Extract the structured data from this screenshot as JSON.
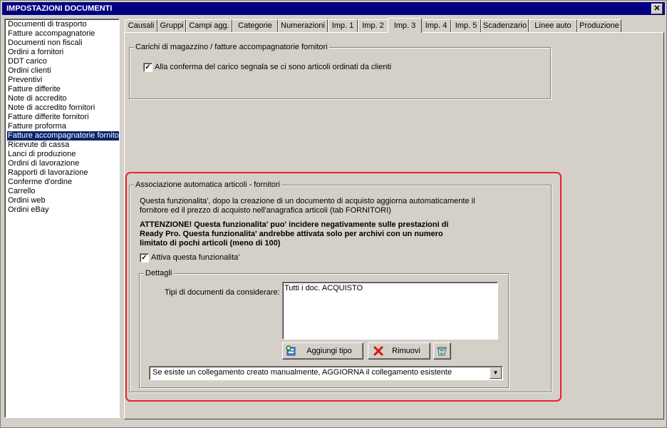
{
  "window": {
    "title": "IMPOSTAZIONI DOCUMENTI",
    "close_glyph": "✕"
  },
  "doc_list": {
    "items": [
      "Documenti di trasporto",
      "Fatture accompagnatorie",
      "Documenti non fiscali",
      "Ordini a fornitori",
      "DDT carico",
      "Ordini clienti",
      "Preventivi",
      "Fatture differite",
      "Note di accredito",
      "Note di accredito fornitori",
      "Fatture differite fornitori",
      "Fatture proforma",
      "Fatture accompagnatorie fornito",
      "Ricevute di cassa",
      "Lanci di produzione",
      "Ordini di lavorazione",
      "Rapporti di lavorazione",
      "Conferme d'ordine",
      "Carrello",
      "Ordini web",
      "Ordini eBay"
    ],
    "selected": "Fatture accompagnatorie fornito"
  },
  "tabs": [
    "Causali",
    "Gruppi",
    "Campi agg.",
    "Categorie",
    "Numerazioni",
    "Imp. 1",
    "Imp. 2",
    "Imp. 3",
    "Imp. 4",
    "Imp. 5",
    "Scadenzario",
    "Linee auto",
    "Produzione"
  ],
  "active_tab": "Imp. 3",
  "carichi_group": {
    "legend": "Carichi di magazzino / fatture accompagnatorie fornitori",
    "checkbox_label": "Alla conferma del carico segnala se ci sono articoli ordinati da clienti",
    "checked": true
  },
  "assoc_group": {
    "legend": "Associazione automatica articoli - fornitori",
    "desc_line1": "Questa funzionalita', dopo la creazione di un documento di acquisto aggiorna automaticamente il",
    "desc_line2": "fornitore ed il prezzo di acquisto nell'anagrafica articoli (tab FORNITORI)",
    "warn_line1": "ATTENZIONE! Questa funzionalita' puo' incidere negativamente sulle prestazioni di",
    "warn_line2": "Ready Pro. Questa funzionalita' andrebbe attivata solo per archivi con un numero",
    "warn_line3": "limitato di pochi articoli (meno di 100)",
    "enable_label": "Attiva questa funzionalita'",
    "enabled": true,
    "details": {
      "legend": "Dettagli",
      "doc_types_label": "Tipi di documenti da considerare:",
      "doc_types": [
        "Tutti i doc. ACQUISTO"
      ],
      "add_button": "Aggiungi tipo",
      "remove_button": "Rimuovi",
      "combo_value": "Se esiste un collegamento creato manualmente, AGGIORNA il collegamento esistente"
    }
  },
  "colors": {
    "highlight": "#e8232a",
    "selection": "#0a246a",
    "titlebar": "#000080"
  }
}
